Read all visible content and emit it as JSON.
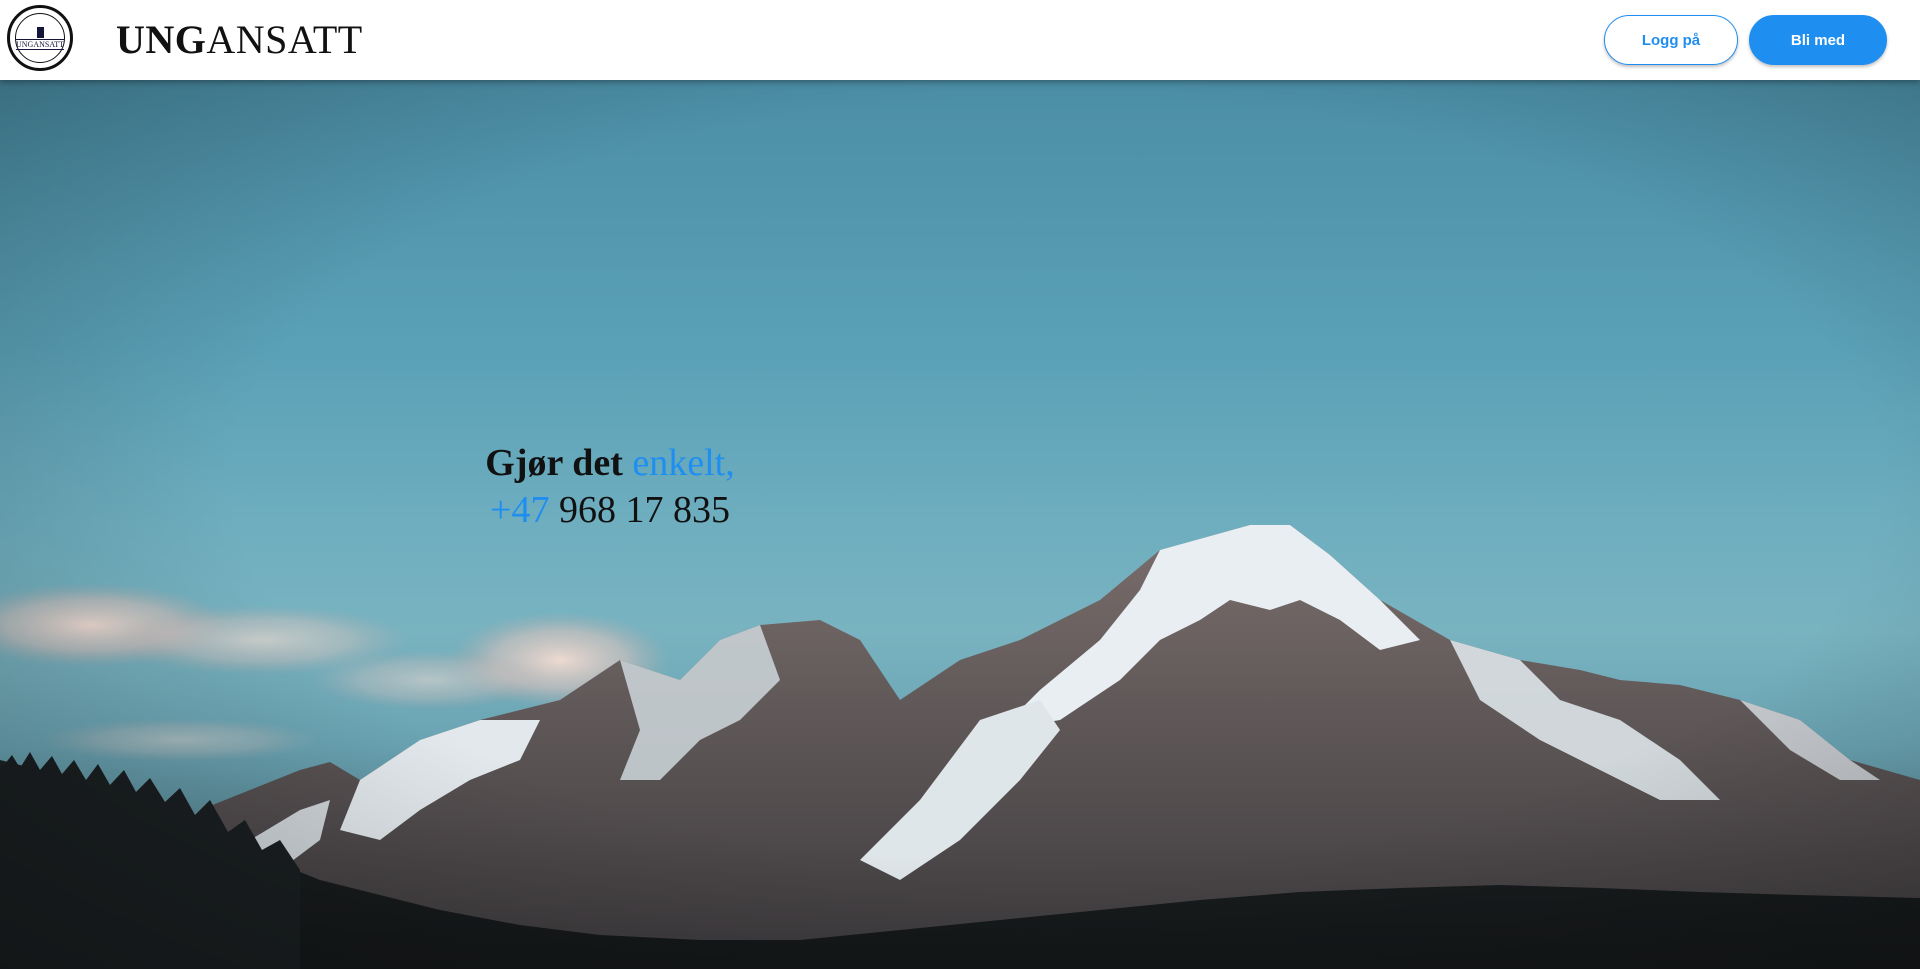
{
  "header": {
    "logo_text": "UNGANSATT",
    "brand_bold": "UNG",
    "brand_rest": "ANSATT",
    "login_label": "Logg på",
    "join_label": "Bli med"
  },
  "hero": {
    "line1_plain": "Gjør det ",
    "line1_accent": "enkelt,",
    "line2_accent": "+47",
    "line2_plain": " 968 17 835",
    "background": "mountain-landscape"
  },
  "colors": {
    "accent": "#1f8ef1",
    "text": "#111111",
    "header_bg": "#ffffff"
  }
}
